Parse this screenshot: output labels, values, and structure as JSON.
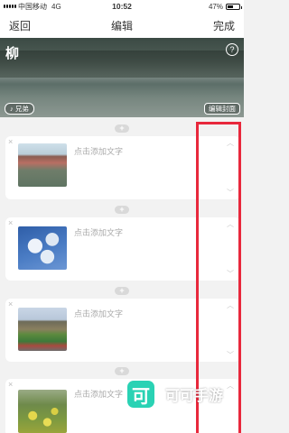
{
  "status": {
    "carrier": "中国移动",
    "network": "4G",
    "time": "10:52",
    "battery": "47%",
    "battery_level": 0.47
  },
  "nav": {
    "back_label": "返回",
    "title": "编辑",
    "done_label": "完成"
  },
  "cover": {
    "title": "柳",
    "help": "?",
    "music_label": "♪ 兄弟",
    "edit_cover_label": "编辑封面"
  },
  "cards": [
    {
      "placeholder": "点击添加文字"
    },
    {
      "placeholder": "点击添加文字"
    },
    {
      "placeholder": "点击添加文字"
    },
    {
      "placeholder": "点击添加文字"
    }
  ],
  "icons": {
    "close": "×",
    "add": "+",
    "chevron_up": "︿",
    "chevron_down": "﹀"
  },
  "watermark": {
    "logo": "可",
    "text": "可可手游"
  },
  "colors": {
    "highlight": "#e8283c",
    "watermark": "#2ad2b4"
  }
}
